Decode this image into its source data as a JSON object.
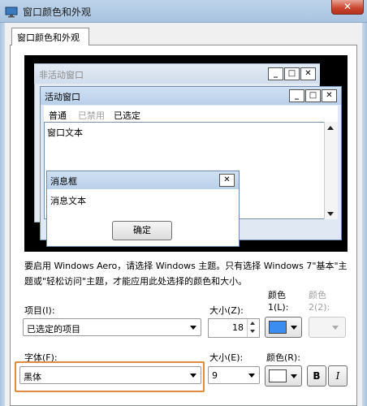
{
  "window": {
    "title": "窗口颜色和外观",
    "close_label": "✕"
  },
  "tab": {
    "label": "窗口颜色和外观"
  },
  "preview": {
    "inactive_title": "非活动窗口",
    "active_title": "活动窗口",
    "menu": [
      "普通",
      "已禁用",
      "已选定"
    ],
    "window_text": "窗口文本",
    "msgbox_title": "消息框",
    "msgbox_text": "消息文本",
    "ok_label": "确定",
    "caption_buttons": [
      "_",
      "□",
      "✕"
    ]
  },
  "info_text": "要启用 Windows Aero，请选择 Windows 主题。只有选择 Windows 7\"基本\"主题或\"轻松访问\"主题，才能应用此处选择的颜色和大小。",
  "form": {
    "item_label": "项目(I):",
    "item_value": "已选定的项目",
    "size_z_label": "大小(Z):",
    "size_z_value": "18",
    "color1_label_a": "颜色",
    "color1_label_b": "1(L):",
    "color1_value": "#3b8df0",
    "color2_label_a": "颜色",
    "color2_label_b": "2(2):",
    "font_label": "字体(F):",
    "font_value": "黑体",
    "size_e_label": "大小(E):",
    "size_e_value": "9",
    "color_r_label": "颜色(R):",
    "color_r_value": "#ffffff",
    "bold_label": "B",
    "italic_label": "I"
  },
  "colors": {
    "highlight": "#e08a3c",
    "titlebar": "#bcd3ea",
    "close": "#c9442b"
  }
}
